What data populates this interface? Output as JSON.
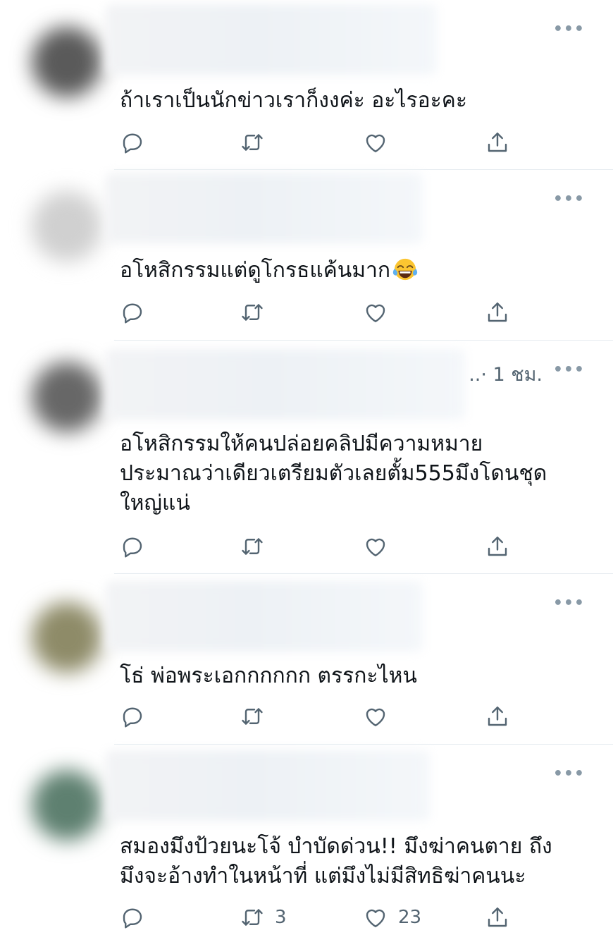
{
  "feed": {
    "tweets": [
      {
        "text": "ถ้าเราเป็นนักข่าวเราก็งงค่ะ อะไรอะคะ",
        "timestamp": "",
        "retweets": "",
        "likes": "",
        "avatar_color": "#5a5a5a"
      },
      {
        "text": "อโหสิกรรมแต่ดูโกรธแค้นมาก",
        "emoji": "face-with-tears-of-joy",
        "timestamp": "",
        "retweets": "",
        "likes": "",
        "avatar_color": "#cfcfcf"
      },
      {
        "text": "อโหสิกรรมให้คนปล่อยคลิปมีความหมาย\nประมาณว่าเดียวเตรียมตัวเลยตั้ม555มึงโดนชุด\nใหญ่แน่",
        "timestamp": "..· 1 ชม.",
        "retweets": "",
        "likes": "",
        "avatar_color": "#6a6a6a"
      },
      {
        "text": "โธ่ พ่อพระเอกกกกกก ตรรกะไหน",
        "timestamp": "",
        "retweets": "",
        "likes": "",
        "avatar_color": "#8c8a6a"
      },
      {
        "text": "สมองมึงป้วยนะโจ้ บำบัดด่วน!! มึงฆ่าคนตาย ถึง\nมึงจะอ้างทำในหน้าที่ แต่มึงไม่มีสิทธิฆ่าคนนะ",
        "timestamp": "",
        "retweets": "3",
        "likes": "23",
        "avatar_color": "#5f8070"
      }
    ]
  },
  "icons": {
    "reply": "reply-icon",
    "retweet": "retweet-icon",
    "like": "like-icon",
    "share": "share-icon",
    "more": "more-options-icon"
  },
  "colors": {
    "icon": "#536471",
    "divider": "#e6ecf0",
    "text": "#0f1419"
  }
}
